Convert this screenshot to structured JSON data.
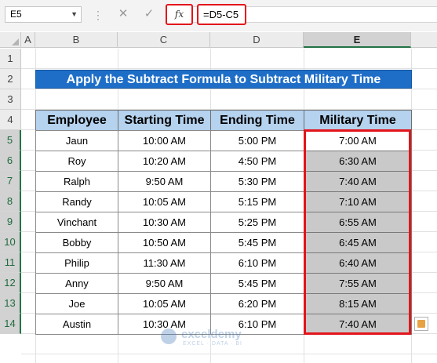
{
  "name_box": "E5",
  "formula": "=D5-C5",
  "fx_label": "fx",
  "columns": [
    "A",
    "B",
    "C",
    "D",
    "E"
  ],
  "rows": [
    "1",
    "2",
    "3",
    "4",
    "5",
    "6",
    "7",
    "8",
    "9",
    "10",
    "11",
    "12",
    "13",
    "14"
  ],
  "title": "Apply the Subtract Formula to Subtract Military Time",
  "headers": [
    "Employee",
    "Starting Time",
    "Ending Time",
    "Military Time"
  ],
  "data": [
    [
      "Jaun",
      "10:00 AM",
      "5:00 PM",
      "7:00 AM"
    ],
    [
      "Roy",
      "10:20 AM",
      "4:50 PM",
      "6:30 AM"
    ],
    [
      "Ralph",
      "9:50 AM",
      "5:30 PM",
      "7:40 AM"
    ],
    [
      "Randy",
      "10:05 AM",
      "5:15 PM",
      "7:10 AM"
    ],
    [
      "Vinchant",
      "10:30 AM",
      "5:25 PM",
      "6:55 AM"
    ],
    [
      "Bobby",
      "10:50 AM",
      "5:45 PM",
      "6:45 AM"
    ],
    [
      "Philip",
      "11:30 AM",
      "6:10 PM",
      "6:40 AM"
    ],
    [
      "Anny",
      "9:50 AM",
      "5:45 PM",
      "7:55 AM"
    ],
    [
      "Joe",
      "10:05 AM",
      "6:20 PM",
      "8:15 AM"
    ],
    [
      "Austin",
      "10:30 AM",
      "6:10 PM",
      "7:40 AM"
    ]
  ],
  "watermark": {
    "brand": "exceldemy",
    "tagline": "EXCEL · DATA · BI"
  },
  "colors": {
    "accent_red": "#e3141b",
    "title_bg": "#1e6ec8",
    "header_bg": "#b5d2ee",
    "selected_bg": "#c9c9c9"
  }
}
